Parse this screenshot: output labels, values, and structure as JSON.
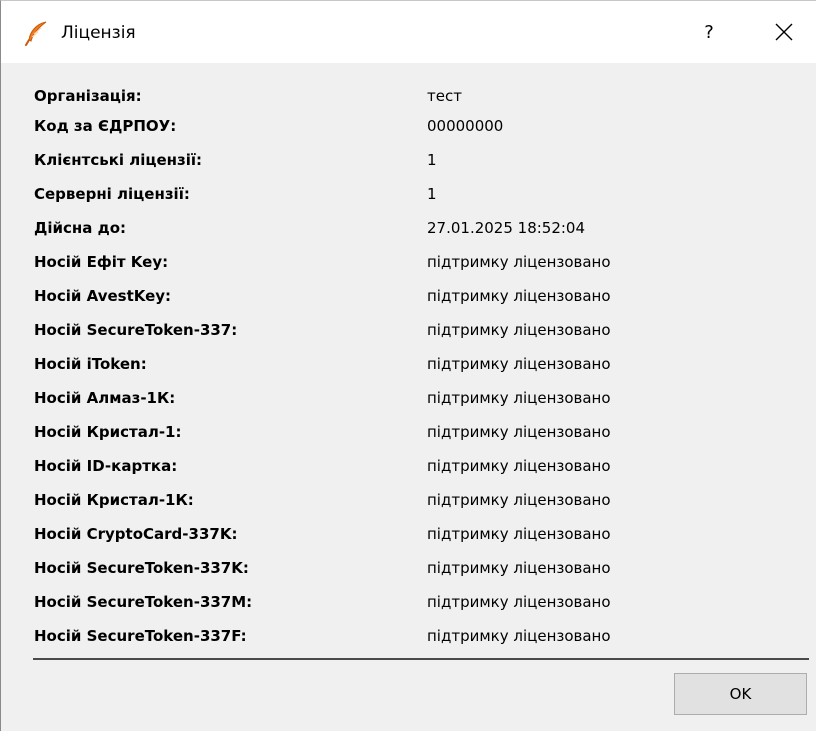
{
  "window": {
    "title": "Ліцензія",
    "help_label": "?",
    "app_icon": "feather-pen-icon",
    "accent_color": "#f07b1e"
  },
  "license_info": [
    {
      "label": "Організація:",
      "value": "тест"
    },
    {
      "label": "Код за ЄДРПОУ:",
      "value": "00000000"
    },
    {
      "label": "Клієнтські ліцензії:",
      "value": "1"
    },
    {
      "label": "Серверні ліцензії:",
      "value": "1"
    },
    {
      "label": "Дійсна до:",
      "value": "27.01.2025 18:52:04"
    },
    {
      "label": "Носій Ефіт Key:",
      "value": "підтримку ліцензовано"
    },
    {
      "label": "Носій AvestKey:",
      "value": "підтримку ліцензовано"
    },
    {
      "label": "Носій SecureToken-337:",
      "value": "підтримку ліцензовано"
    },
    {
      "label": "Носій iToken:",
      "value": "підтримку ліцензовано"
    },
    {
      "label": "Носій Алмаз-1К:",
      "value": "підтримку ліцензовано"
    },
    {
      "label": "Носій Кристал-1:",
      "value": "підтримку ліцензовано"
    },
    {
      "label": "Носій ID-картка:",
      "value": "підтримку ліцензовано"
    },
    {
      "label": "Носій Кристал-1К:",
      "value": "підтримку ліцензовано"
    },
    {
      "label": "Носій CryptoCard-337K:",
      "value": "підтримку ліцензовано"
    },
    {
      "label": "Носій SecureToken-337K:",
      "value": "підтримку ліцензовано"
    },
    {
      "label": "Носій SecureToken-337M:",
      "value": "підтримку ліцензовано"
    },
    {
      "label": "Носій SecureToken-337F:",
      "value": "підтримку ліцензовано"
    }
  ],
  "footer": {
    "ok_label": "OK"
  }
}
